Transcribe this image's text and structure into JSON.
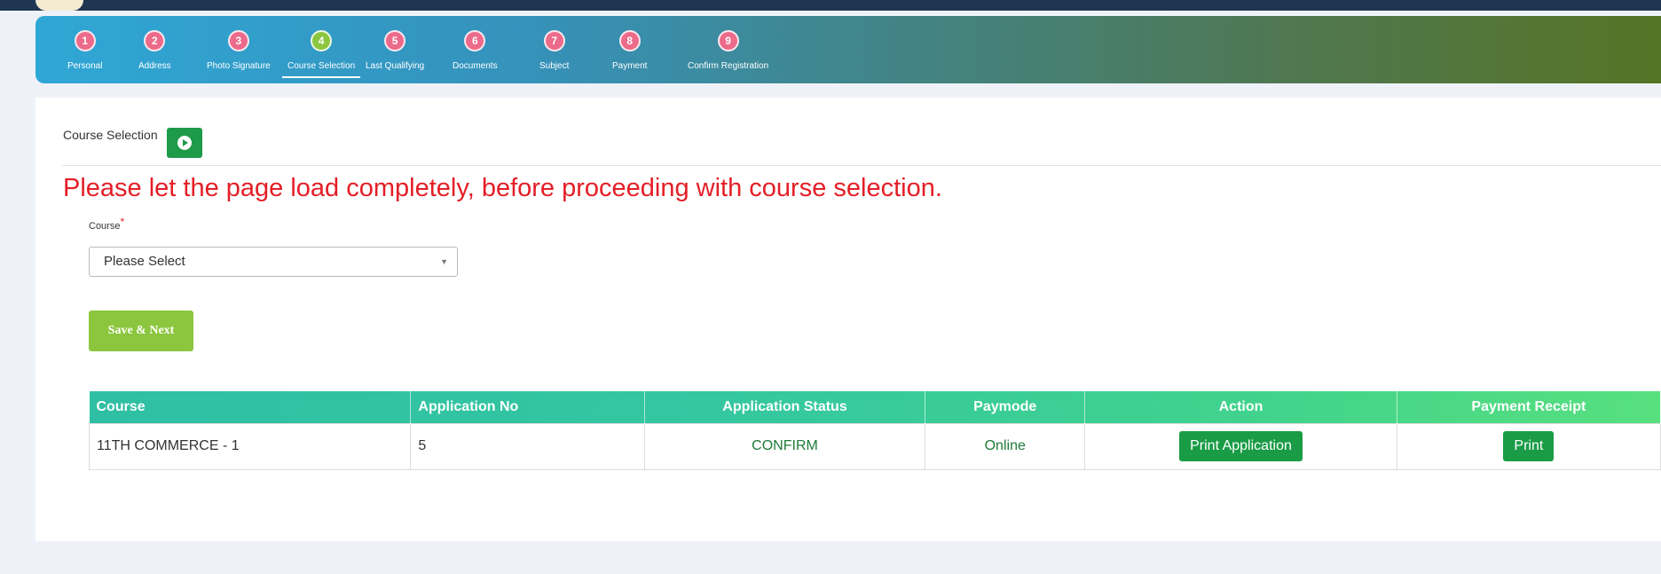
{
  "steps": [
    {
      "num": "1",
      "label": "Personal"
    },
    {
      "num": "2",
      "label": "Address"
    },
    {
      "num": "3",
      "label": "Photo Signature"
    },
    {
      "num": "4",
      "label": "Course Selection"
    },
    {
      "num": "5",
      "label": "Last Qualifying"
    },
    {
      "num": "6",
      "label": "Documents"
    },
    {
      "num": "7",
      "label": "Subject"
    },
    {
      "num": "8",
      "label": "Payment"
    },
    {
      "num": "9",
      "label": "Confirm Registration"
    }
  ],
  "section": {
    "title": "Course Selection"
  },
  "warning": "Please let the page load completely, before proceeding with course selection.",
  "course_field": {
    "label": "Course",
    "required_mark": "*",
    "selected": "Please Select",
    "chevron": "▼"
  },
  "save_button": "Save & Next",
  "table": {
    "headers": [
      "Course",
      "Application No",
      "Application Status",
      "Paymode",
      "Action",
      "Payment Receipt"
    ],
    "rows": [
      {
        "course": "11TH COMMERCE - 1",
        "application_no": "5",
        "status": "CONFIRM",
        "paymode": "Online",
        "action_label": "Print Application",
        "receipt_label": "Print"
      }
    ]
  },
  "colors": {
    "active_step": "#8cc63e",
    "pending_step": "#ec6a8a",
    "warning": "#e41e26",
    "primary_green": "#1a9c46"
  }
}
